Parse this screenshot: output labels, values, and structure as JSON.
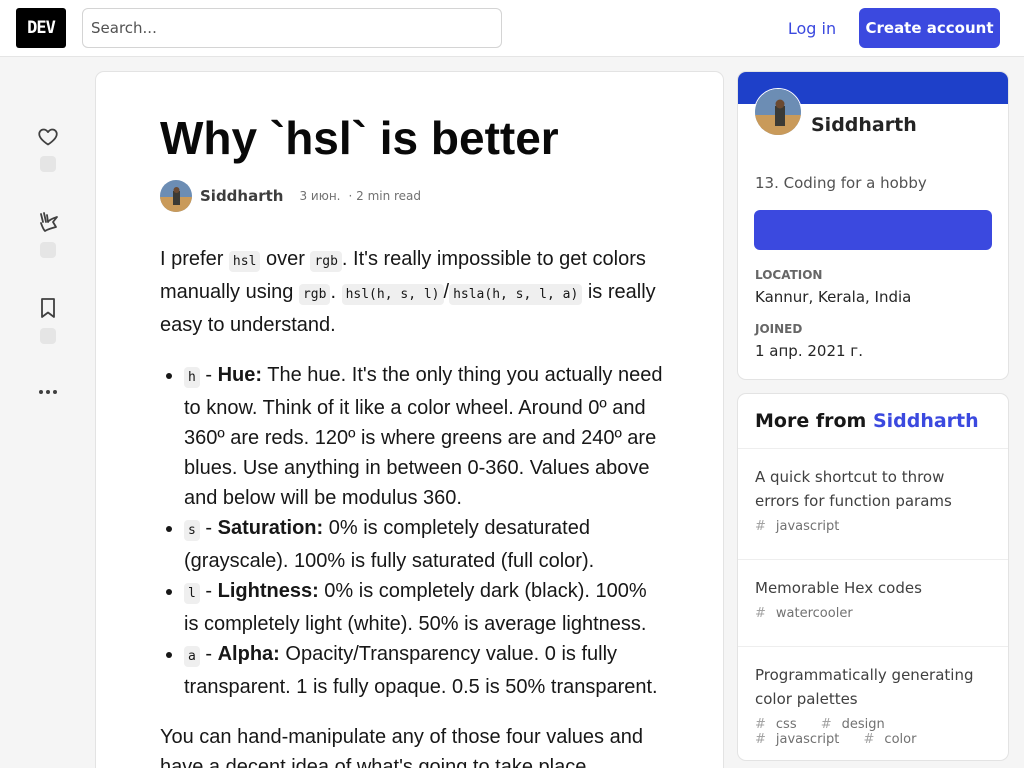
{
  "header": {
    "logo": "DEV",
    "search_placeholder": "Search...",
    "login": "Log in",
    "create_account": "Create account"
  },
  "article": {
    "title": "Why `hsl` is better",
    "author": "Siddharth",
    "date": "3 июн.",
    "read_time": "· 2 min read",
    "p1": {
      "t1": "I prefer ",
      "c1": "hsl",
      "t2": " over ",
      "c2": "rgb",
      "t3": ". It's really impossible to get colors manually using ",
      "c3": "rgb",
      "t4": ". ",
      "c4": "hsl(h, s, l)",
      "t5": "/",
      "c5": "hsla(h, s, l, a)",
      "t6": " is really easy to understand."
    },
    "list": [
      {
        "code": "h",
        "sep": " - ",
        "label": "Hue:",
        "text": " The hue. It's the only thing you actually need to know. Think of it like a color wheel. Around 0º and 360º are reds. 120º is where greens are and 240º are blues. Use anything in between 0-360. Values above and below will be modulus 360."
      },
      {
        "code": "s",
        "sep": " - ",
        "label": "Saturation:",
        "text": " 0% is completely desaturated (grayscale). 100% is fully saturated (full color)."
      },
      {
        "code": "l",
        "sep": " - ",
        "label": "Lightness:",
        "text": " 0% is completely dark (black). 100% is completely light (white). 50% is average lightness."
      },
      {
        "code": "a",
        "sep": " - ",
        "label": "Alpha:",
        "text": " Opacity/Transparency value. 0 is fully transparent. 1 is fully opaque. 0.5 is 50% transparent."
      }
    ],
    "p2": "You can hand-manipulate any of those four values and have a decent idea of what's going to take place."
  },
  "profile": {
    "name": "Siddharth",
    "bio": "13. Coding for a hobby",
    "location_label": "LOCATION",
    "location": "Kannur, Kerala, India",
    "joined_label": "JOINED",
    "joined": "1 апр. 2021 г."
  },
  "more_from": {
    "prefix": "More from ",
    "author": "Siddharth",
    "items": [
      {
        "title": "A quick shortcut to throw errors for function params",
        "tags": [
          "javascript"
        ]
      },
      {
        "title": "Memorable Hex codes",
        "tags": [
          "watercooler"
        ]
      },
      {
        "title": "Programmatically generating color palettes",
        "tags": [
          "css",
          "design",
          "javascript",
          "color"
        ]
      }
    ]
  },
  "colors": {
    "accent": "#3b49df",
    "profile_band": "#1e40c9"
  },
  "icons": [
    "heart-icon",
    "unicorn-icon",
    "bookmark-icon",
    "more-icon"
  ]
}
